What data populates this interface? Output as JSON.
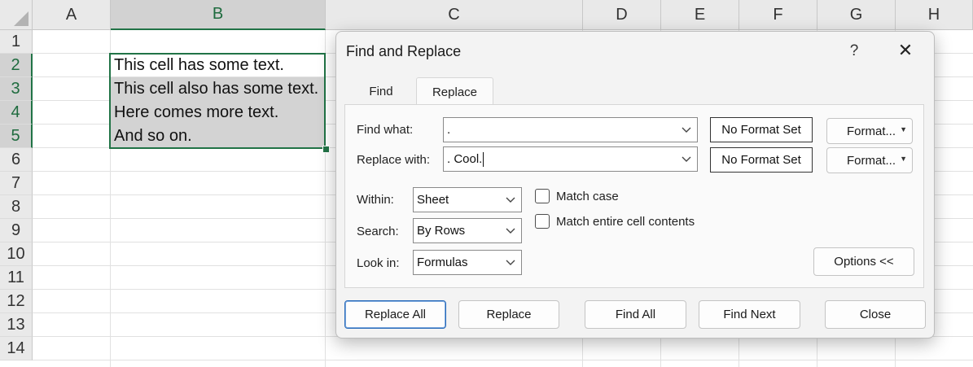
{
  "spreadsheet": {
    "columns": [
      "A",
      "B",
      "C",
      "D",
      "E",
      "F",
      "G",
      "H"
    ],
    "rows": [
      "1",
      "2",
      "3",
      "4",
      "5",
      "6",
      "7",
      "8",
      "9",
      "10",
      "11",
      "12",
      "13",
      "14"
    ],
    "selected_column": "B",
    "cells": [
      {
        "ref": "B2",
        "text": "This cell has some text."
      },
      {
        "ref": "B3",
        "text": "This cell also has some text."
      },
      {
        "ref": "B4",
        "text": "Here comes more text."
      },
      {
        "ref": "B5",
        "text": "And so on."
      }
    ]
  },
  "dialog": {
    "title": "Find and Replace",
    "help_glyph": "?",
    "close_glyph": "✕",
    "tabs": {
      "find": "Find",
      "replace": "Replace"
    },
    "find_what": {
      "label": "Find what:",
      "value": "."
    },
    "replace_with": {
      "label": "Replace with:",
      "value": ". Cool."
    },
    "format_status": "No Format Set",
    "format_button": "Format...",
    "within": {
      "label": "Within:",
      "value": "Sheet"
    },
    "search": {
      "label": "Search:",
      "value": "By Rows"
    },
    "look_in": {
      "label": "Look in:",
      "value": "Formulas"
    },
    "match_case": "Match case",
    "match_entire": "Match entire cell contents",
    "options_button": "Options <<",
    "buttons": {
      "replace_all": "Replace All",
      "replace": "Replace",
      "find_all": "Find All",
      "find_next": "Find Next",
      "close": "Close"
    }
  },
  "colors": {
    "accent": "#217346",
    "selection": "#d3d3d3",
    "primary_button_border": "#2a6cba"
  }
}
